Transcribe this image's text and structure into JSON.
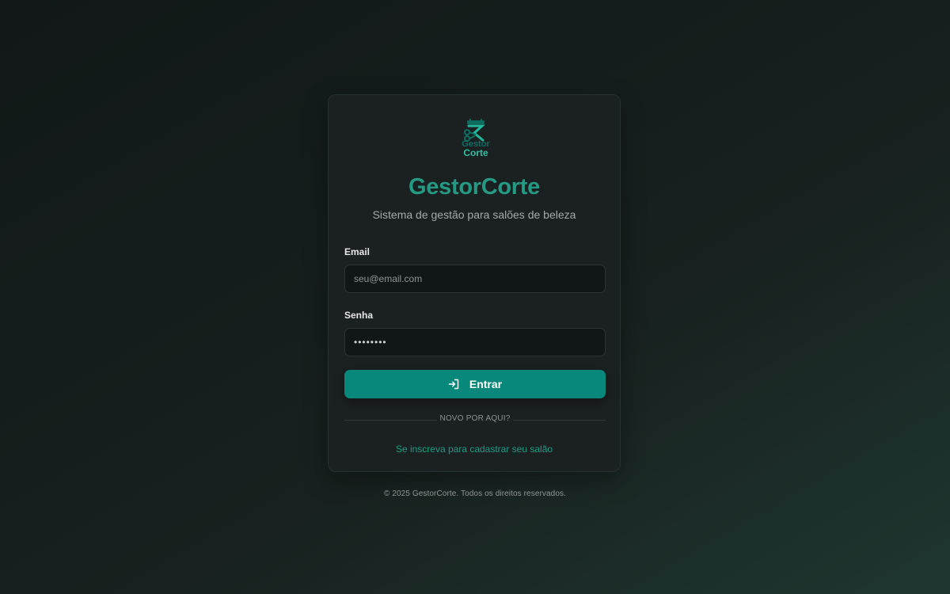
{
  "brand": {
    "logo_line1": "Gestor",
    "logo_line2": "Corte",
    "title": "GestorCorte",
    "subtitle": "Sistema de gestão para salões de beleza"
  },
  "form": {
    "email_label": "Email",
    "email_placeholder": "seu@email.com",
    "email_value": "",
    "password_label": "Senha",
    "password_value": "••••••••",
    "submit_label": "Entrar",
    "submit_icon": "login-icon"
  },
  "divider": {
    "text": "NOVO POR AQUI?"
  },
  "signup": {
    "link_text": "Se inscreva para cadastrar seu salão"
  },
  "footer": {
    "copyright": "© 2025 GestorCorte. Todos os direitos reservados."
  },
  "colors": {
    "accent": "#07887b",
    "title": "#249a84",
    "link": "#1f9c86"
  }
}
